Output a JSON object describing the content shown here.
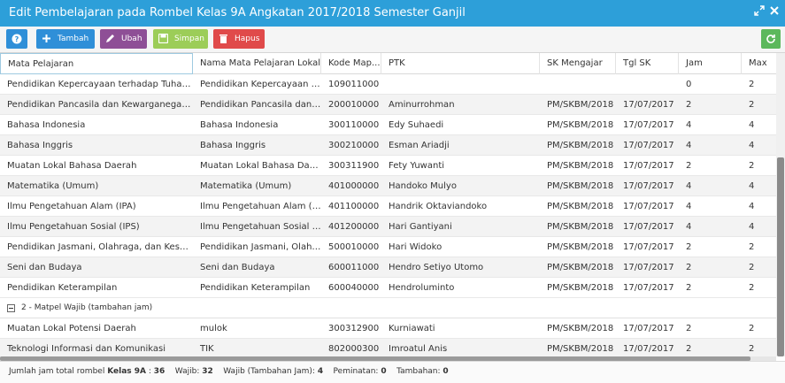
{
  "window": {
    "title": "Edit Pembelajaran pada Rombel Kelas 9A Angkatan 2017/2018 Semester Ganjil",
    "icons": [
      "expand-icon",
      "close-icon"
    ],
    "title_bar_color": "#2d9fd9"
  },
  "toolbar": {
    "help_icon": "question-icon",
    "tambah_label": "Tambah",
    "ubah_label": "Ubah",
    "simpan_label": "Simpan",
    "hapus_label": "Hapus",
    "refresh_icon": "refresh-icon",
    "colors": {
      "help": "#2f8fd8",
      "tambah": "#2f8fd8",
      "ubah": "#8e4f96",
      "simpan": "#9ccd58",
      "hapus": "#e04a4a",
      "refresh": "#5cb85c"
    }
  },
  "columns": [
    "Mata Pelajaran",
    "Nama Mata Pelajaran Lokal",
    "Kode Map...",
    "PTK",
    "SK Mengajar",
    "Tgl SK",
    "Jam",
    "Max"
  ],
  "rows": [
    [
      "Pendidikan Kepercayaan terhadap Tuhan YME",
      "Pendidikan Kepercayaan ter...",
      "109011000",
      "",
      "",
      "",
      "0",
      "2"
    ],
    [
      "Pendidikan Pancasila dan Kewarganegaraan",
      "Pendidikan Pancasila dan K...",
      "200010000",
      "Aminurrohman",
      "PM/SKBM/2018",
      "17/07/2017",
      "2",
      "2"
    ],
    [
      "Bahasa Indonesia",
      "Bahasa Indonesia",
      "300110000",
      "Edy Suhaedi",
      "PM/SKBM/2018",
      "17/07/2017",
      "4",
      "4"
    ],
    [
      "Bahasa Inggris",
      "Bahasa Inggris",
      "300210000",
      "Esman Ariadji",
      "PM/SKBM/2018",
      "17/07/2017",
      "4",
      "4"
    ],
    [
      "Muatan Lokal Bahasa Daerah",
      "Muatan Lokal Bahasa Daerah",
      "300311900",
      "Fety Yuwanti",
      "PM/SKBM/2018",
      "17/07/2017",
      "2",
      "2"
    ],
    [
      "Matematika (Umum)",
      "Matematika (Umum)",
      "401000000",
      "Handoko Mulyo",
      "PM/SKBM/2018",
      "17/07/2017",
      "4",
      "4"
    ],
    [
      "Ilmu Pengetahuan Alam (IPA)",
      "Ilmu Pengetahuan Alam (IPA)",
      "401100000",
      "Handrik Oktaviandoko",
      "PM/SKBM/2018",
      "17/07/2017",
      "4",
      "4"
    ],
    [
      "Ilmu Pengetahuan Sosial (IPS)",
      "Ilmu Pengetahuan Sosial (IPS)",
      "401200000",
      "Hari Gantiyani",
      "PM/SKBM/2018",
      "17/07/2017",
      "4",
      "4"
    ],
    [
      "Pendidikan Jasmani, Olahraga, dan Kesehatan",
      "Pendidikan Jasmani, Olahra...",
      "500010000",
      "Hari Widoko",
      "PM/SKBM/2018",
      "17/07/2017",
      "2",
      "2"
    ],
    [
      "Seni dan Budaya",
      "Seni dan Budaya",
      "600011000",
      "Hendro Setiyo Utomo",
      "PM/SKBM/2018",
      "17/07/2017",
      "2",
      "2"
    ],
    [
      "Pendidikan Keterampilan",
      "Pendidikan Keterampilan",
      "600040000",
      "Hendroluminto",
      "PM/SKBM/2018",
      "17/07/2017",
      "2",
      "2"
    ]
  ],
  "group": {
    "label": "2 - Matpel Wajib (tambahan jam)",
    "icon": "collapse-icon"
  },
  "group_rows": [
    [
      "Muatan Lokal Potensi Daerah",
      "mulok",
      "300312900",
      "Kurniawati",
      "PM/SKBM/2018",
      "17/07/2017",
      "2",
      "2"
    ],
    [
      "Teknologi Informasi dan Komunikasi",
      "TIK",
      "802000300",
      "Imroatul Anis",
      "PM/SKBM/2018",
      "17/07/2017",
      "2",
      "2"
    ]
  ],
  "footer": {
    "prefix": "Jumlah jam total rombel",
    "kelas": "Kelas 9A",
    "total_sep": ":",
    "total": "36",
    "wajib_label": "Wajib:",
    "wajib": "32",
    "tambahan_jam_label": "Wajib (Tambahan Jam):",
    "tambahan_jam": "4",
    "peminatan_label": "Peminatan:",
    "peminatan": "0",
    "tambahan_label": "Tambahan:",
    "tambahan": "0"
  }
}
